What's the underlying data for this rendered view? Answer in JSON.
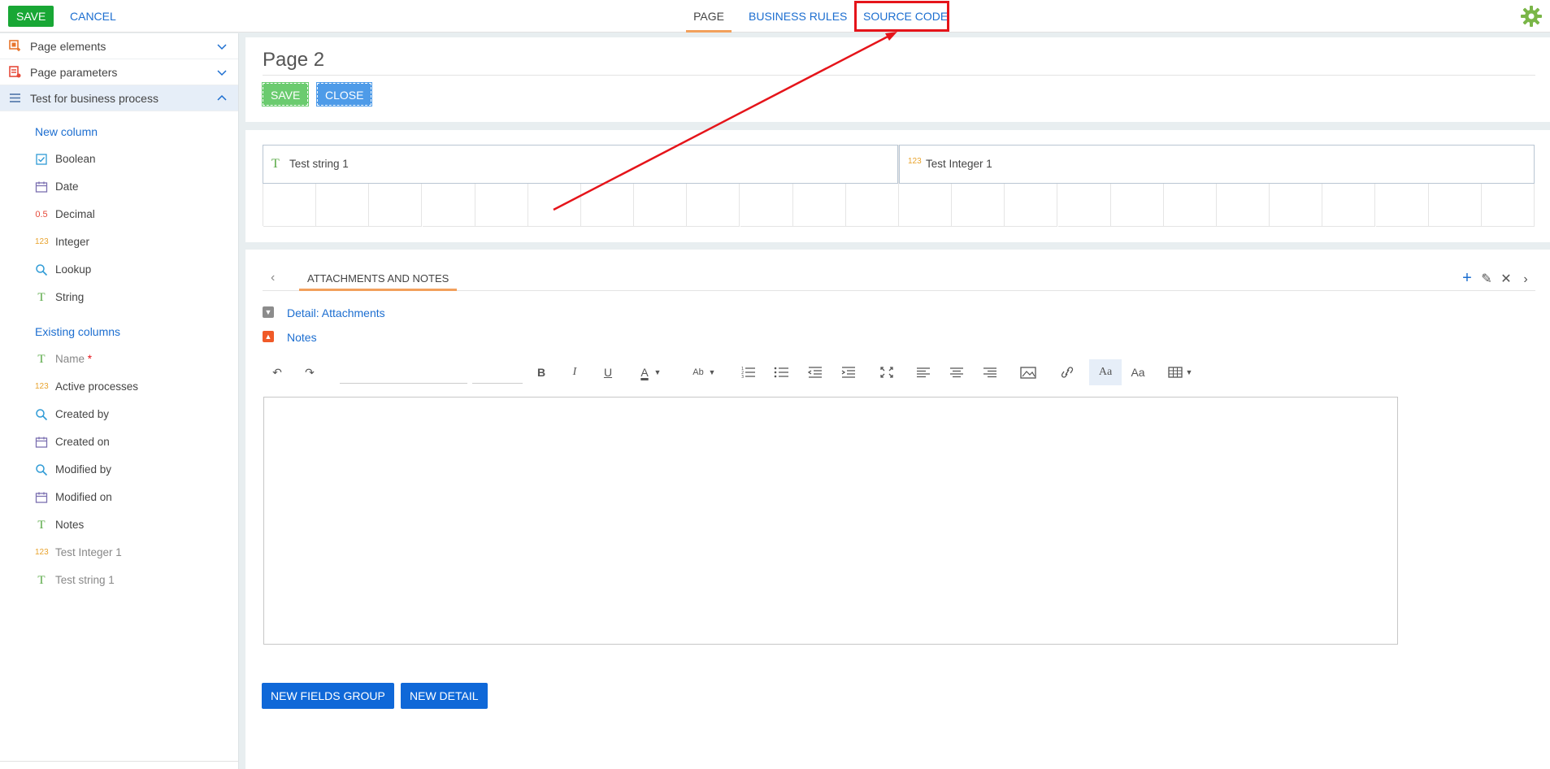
{
  "topbar": {
    "save_label": "SAVE",
    "cancel_label": "CANCEL",
    "tabs": [
      {
        "label": "PAGE",
        "active": true
      },
      {
        "label": "BUSINESS RULES",
        "active": false
      },
      {
        "label": "SOURCE CODE",
        "active": false,
        "highlighted": true
      }
    ]
  },
  "sidebar": {
    "sections": [
      {
        "label": "Page elements",
        "icon": "page-elements-icon",
        "expanded": false
      },
      {
        "label": "Page parameters",
        "icon": "page-parameters-icon",
        "expanded": false
      },
      {
        "label": "Test for business process",
        "icon": "list-icon",
        "expanded": true
      }
    ],
    "new_columns_title": "New column",
    "new_columns": [
      {
        "label": "Boolean",
        "icon": "checkbox-icon"
      },
      {
        "label": "Date",
        "icon": "calendar-icon"
      },
      {
        "label": "Decimal",
        "icon": "decimal-icon",
        "glyph": "0.5"
      },
      {
        "label": "Integer",
        "icon": "integer-icon",
        "glyph": "123"
      },
      {
        "label": "Lookup",
        "icon": "search-icon"
      },
      {
        "label": "String",
        "icon": "string-icon",
        "glyph": "T"
      }
    ],
    "existing_columns_title": "Existing columns",
    "existing_columns": [
      {
        "label": "Name",
        "icon": "string-icon",
        "glyph": "T",
        "required_mark": "*",
        "muted": true
      },
      {
        "label": "Active processes",
        "icon": "integer-icon",
        "glyph": "123",
        "muted": false
      },
      {
        "label": "Created by",
        "icon": "search-icon",
        "muted": false
      },
      {
        "label": "Created on",
        "icon": "calendar-icon",
        "muted": false
      },
      {
        "label": "Modified by",
        "icon": "search-icon",
        "muted": false
      },
      {
        "label": "Modified on",
        "icon": "calendar-icon",
        "muted": false
      },
      {
        "label": "Notes",
        "icon": "string-icon",
        "glyph": "T",
        "muted": false
      },
      {
        "label": "Test Integer 1",
        "icon": "integer-icon",
        "glyph": "123",
        "muted": true
      },
      {
        "label": "Test string 1",
        "icon": "string-icon",
        "glyph": "T",
        "muted": true
      }
    ]
  },
  "page": {
    "title": "Page 2",
    "save_label": "SAVE",
    "close_label": "CLOSE"
  },
  "fields": [
    {
      "label": "Test string 1",
      "icon": "string-icon",
      "glyph": "T"
    },
    {
      "label": "Test Integer 1",
      "icon": "integer-icon",
      "glyph": "123"
    }
  ],
  "details": {
    "tab_label": "ATTACHMENTS AND NOTES",
    "rows": [
      {
        "label": "Detail: Attachments",
        "state": "collapsed"
      },
      {
        "label": "Notes",
        "state": "expanded"
      }
    ]
  },
  "toolbar_glyphs": {
    "undo": "↶",
    "redo": "↷",
    "bold": "B",
    "italic": "I",
    "underline": "U",
    "font_color": "A",
    "highlight": "Ab",
    "font_size_a": "Aa",
    "font_size_b": "Aa"
  },
  "buttons": {
    "new_fields_group": "NEW FIELDS GROUP",
    "new_detail": "NEW DETAIL"
  },
  "colors": {
    "save_green": "#18a735",
    "link_blue": "#1c6ed0",
    "active_tab_underline": "#f2a05c",
    "annotation_red": "#e5141a",
    "primary_button": "#0f68d8"
  }
}
